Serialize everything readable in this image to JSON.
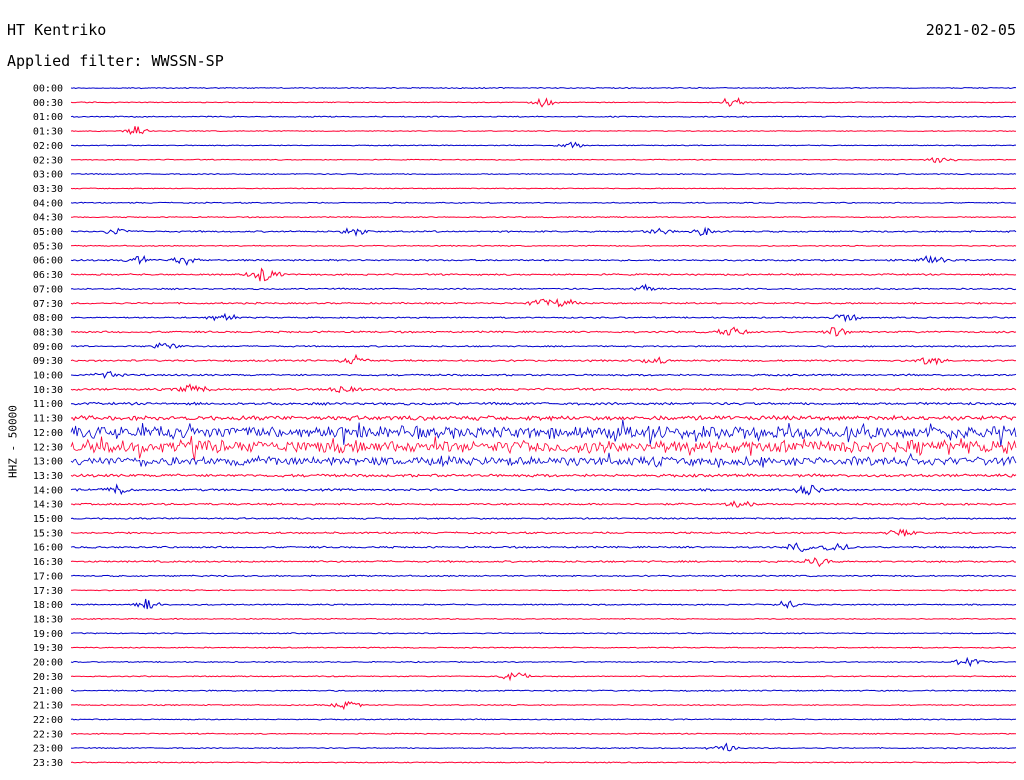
{
  "header": {
    "station": "HT Kentriko",
    "date": "2021-02-05",
    "filter": "Applied filter: WWSSN-SP"
  },
  "channel_label": "HHZ - 50000",
  "chart_data": {
    "type": "line",
    "title": "HT Kentriko",
    "subtitle": "Applied filter: WWSSN-SP",
    "ylabel": "HHZ - 50000",
    "minutes_per_line": 30,
    "trace_colors": [
      "#0000cc",
      "#ff0033"
    ],
    "rows": [
      {
        "time": "00:00",
        "activity": 0.6,
        "events": []
      },
      {
        "time": "00:30",
        "activity": 0.5,
        "events": [
          0.5,
          0.7
        ]
      },
      {
        "time": "01:00",
        "activity": 0.6,
        "events": []
      },
      {
        "time": "01:30",
        "activity": 0.5,
        "events": [
          0.07
        ]
      },
      {
        "time": "02:00",
        "activity": 0.5,
        "events": [
          0.53
        ]
      },
      {
        "time": "02:30",
        "activity": 0.5,
        "events": [
          0.92
        ]
      },
      {
        "time": "03:00",
        "activity": 0.6,
        "events": []
      },
      {
        "time": "03:30",
        "activity": 0.5,
        "events": []
      },
      {
        "time": "04:00",
        "activity": 0.6,
        "events": []
      },
      {
        "time": "04:30",
        "activity": 0.6,
        "events": []
      },
      {
        "time": "05:00",
        "activity": 0.9,
        "events": [
          0.05,
          0.3,
          0.62,
          0.67
        ]
      },
      {
        "time": "05:30",
        "activity": 0.6,
        "events": []
      },
      {
        "time": "06:00",
        "activity": 0.9,
        "events": [
          0.07,
          0.12,
          0.91
        ]
      },
      {
        "time": "06:30",
        "activity": 0.9,
        "events": [
          0.2,
          0.21
        ]
      },
      {
        "time": "07:00",
        "activity": 0.8,
        "events": [
          0.61
        ]
      },
      {
        "time": "07:30",
        "activity": 0.9,
        "events": [
          0.5,
          0.52
        ]
      },
      {
        "time": "08:00",
        "activity": 0.8,
        "events": [
          0.16,
          0.82
        ]
      },
      {
        "time": "08:30",
        "activity": 1.0,
        "events": [
          0.7,
          0.81
        ]
      },
      {
        "time": "09:00",
        "activity": 0.8,
        "events": [
          0.1
        ]
      },
      {
        "time": "09:30",
        "activity": 1.0,
        "events": [
          0.3,
          0.62,
          0.91
        ]
      },
      {
        "time": "10:00",
        "activity": 1.0,
        "events": [
          0.04
        ]
      },
      {
        "time": "10:30",
        "activity": 1.2,
        "events": [
          0.13,
          0.29
        ]
      },
      {
        "time": "11:00",
        "activity": 1.4,
        "events": []
      },
      {
        "time": "11:30",
        "activity": 2.5,
        "events": []
      },
      {
        "time": "12:00",
        "activity": 7.0,
        "events": []
      },
      {
        "time": "12:30",
        "activity": 7.0,
        "events": []
      },
      {
        "time": "13:00",
        "activity": 5.0,
        "events": []
      },
      {
        "time": "13:30",
        "activity": 1.6,
        "events": []
      },
      {
        "time": "14:00",
        "activity": 1.2,
        "events": [
          0.05,
          0.78
        ]
      },
      {
        "time": "14:30",
        "activity": 1.1,
        "events": [
          0.71
        ]
      },
      {
        "time": "15:00",
        "activity": 0.9,
        "events": []
      },
      {
        "time": "15:30",
        "activity": 1.0,
        "events": [
          0.88
        ]
      },
      {
        "time": "16:00",
        "activity": 1.0,
        "events": [
          0.77,
          0.81
        ]
      },
      {
        "time": "16:30",
        "activity": 1.0,
        "events": [
          0.79
        ]
      },
      {
        "time": "17:00",
        "activity": 0.8,
        "events": []
      },
      {
        "time": "17:30",
        "activity": 0.6,
        "events": []
      },
      {
        "time": "18:00",
        "activity": 0.7,
        "events": [
          0.08,
          0.76
        ]
      },
      {
        "time": "18:30",
        "activity": 0.6,
        "events": []
      },
      {
        "time": "19:00",
        "activity": 0.6,
        "events": []
      },
      {
        "time": "19:30",
        "activity": 0.6,
        "events": []
      },
      {
        "time": "20:00",
        "activity": 0.6,
        "events": [
          0.95
        ]
      },
      {
        "time": "20:30",
        "activity": 0.6,
        "events": [
          0.47
        ]
      },
      {
        "time": "21:00",
        "activity": 0.7,
        "events": []
      },
      {
        "time": "21:30",
        "activity": 0.6,
        "events": [
          0.29
        ]
      },
      {
        "time": "22:00",
        "activity": 0.6,
        "events": []
      },
      {
        "time": "22:30",
        "activity": 0.6,
        "events": []
      },
      {
        "time": "23:00",
        "activity": 0.6,
        "events": [
          0.69
        ]
      },
      {
        "time": "23:30",
        "activity": 0.6,
        "events": []
      }
    ]
  }
}
